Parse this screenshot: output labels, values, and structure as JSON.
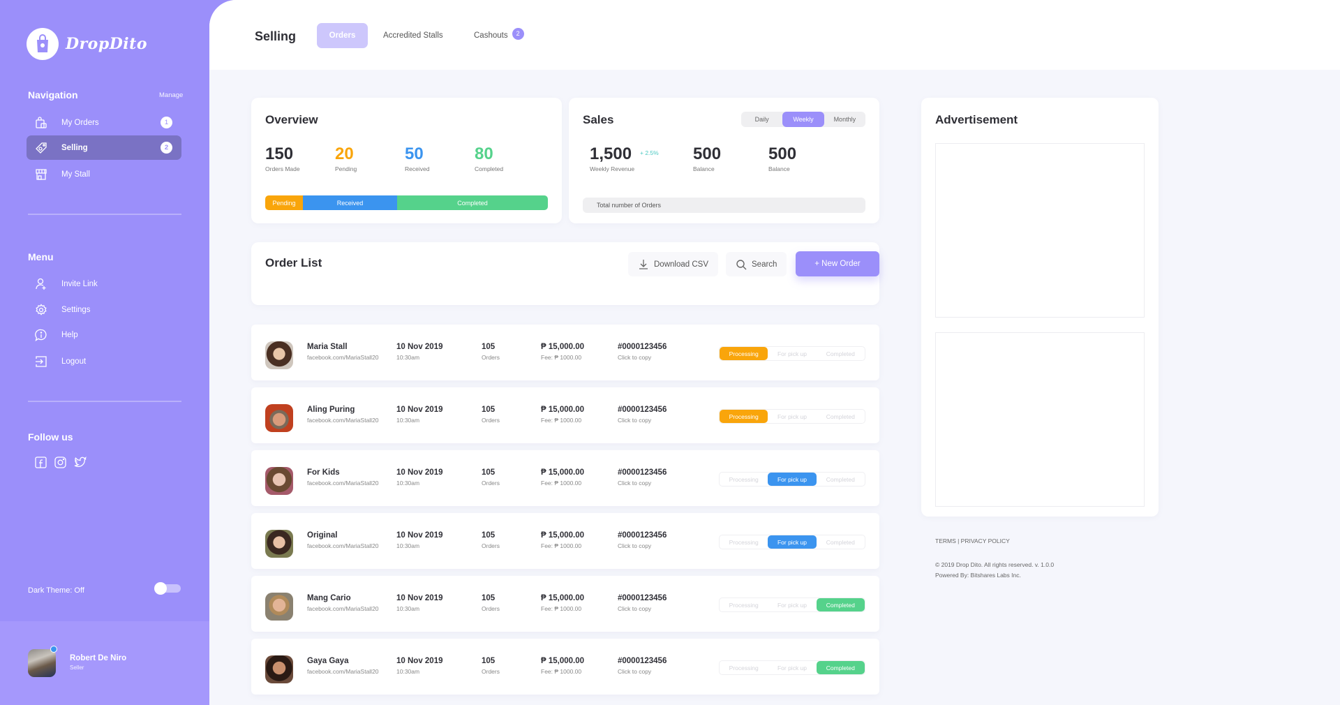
{
  "brand": {
    "name": "DropDito"
  },
  "sidebar": {
    "navigation_title": "Navigation",
    "manage_label": "Manage",
    "nav_items": [
      {
        "label": "My Orders",
        "icon": "shopping-bag-icon",
        "badge": "1"
      },
      {
        "label": "Selling",
        "icon": "tag-icon",
        "badge": "2",
        "active": true
      },
      {
        "label": "My Stall",
        "icon": "store-icon"
      }
    ],
    "menu_title": "Menu",
    "menu_items": [
      {
        "label": "Invite Link",
        "icon": "user-plus-icon"
      },
      {
        "label": "Settings",
        "icon": "gear-icon"
      },
      {
        "label": "Help",
        "icon": "help-chat-icon"
      },
      {
        "label": "Logout",
        "icon": "logout-icon"
      }
    ],
    "follow_title": "Follow us",
    "social": [
      "facebook-icon",
      "instagram-icon",
      "twitter-icon"
    ],
    "dark_theme_label": "Dark Theme: Off",
    "dark_theme_on": false,
    "user": {
      "name": "Robert De Niro",
      "role": "Seller",
      "online": true
    }
  },
  "header": {
    "title": "Selling",
    "tabs": [
      {
        "label": "Orders",
        "active": true
      },
      {
        "label": "Accredited Stalls"
      },
      {
        "label": "Cashouts",
        "badge": "2"
      }
    ]
  },
  "overview": {
    "title": "Overview",
    "stats": [
      {
        "value": "150",
        "label": "Orders Made",
        "color": "#2f2f36"
      },
      {
        "value": "20",
        "label": "Pending",
        "color": "#f9a50b"
      },
      {
        "value": "50",
        "label": "Received",
        "color": "#3b94ef"
      },
      {
        "value": "80",
        "label": "Completed",
        "color": "#55d28b"
      }
    ],
    "bar": [
      {
        "label": "Pending",
        "value": 20,
        "color": "#f9a50b"
      },
      {
        "label": "Received",
        "value": 50,
        "color": "#3b94ef"
      },
      {
        "label": "Completed",
        "value": 80,
        "color": "#55d28b"
      }
    ]
  },
  "sales": {
    "title": "Sales",
    "periods": [
      "Daily",
      "Weekly",
      "Monthly"
    ],
    "active_period": "Weekly",
    "stats": [
      {
        "value": "1,500",
        "label": "Weekly Revenue",
        "growth": "+ 2.5%"
      },
      {
        "value": "500",
        "label": "Balance"
      },
      {
        "value": "500",
        "label": "Balance"
      }
    ],
    "total_orders_label": "Total number of Orders"
  },
  "order_list": {
    "title": "Order List",
    "download_label": "Download CSV",
    "search_label": "Search",
    "new_order_label": "+ New Order",
    "status_options": [
      "Processing",
      "For pick up",
      "Completed"
    ],
    "rows": [
      {
        "name": "Maria Stall",
        "link": "facebook.com/MariaStall20",
        "date": "10 Nov 2019",
        "time": "10:30am",
        "orders": "105",
        "orders_label": "Orders",
        "amount": "₱ 15,000.00",
        "fee": "Fee: ₱ 1000.00",
        "order_id": "#0000123456",
        "copy_label": "Click to copy",
        "status": "Processing"
      },
      {
        "name": "Aling Puring",
        "link": "facebook.com/MariaStall20",
        "date": "10 Nov 2019",
        "time": "10:30am",
        "orders": "105",
        "orders_label": "Orders",
        "amount": "₱ 15,000.00",
        "fee": "Fee: ₱ 1000.00",
        "order_id": "#0000123456",
        "copy_label": "Click to copy",
        "status": "Processing"
      },
      {
        "name": "For Kids",
        "link": "facebook.com/MariaStall20",
        "date": "10 Nov 2019",
        "time": "10:30am",
        "orders": "105",
        "orders_label": "Orders",
        "amount": "₱ 15,000.00",
        "fee": "Fee: ₱ 1000.00",
        "order_id": "#0000123456",
        "copy_label": "Click to copy",
        "status": "For pick up"
      },
      {
        "name": "Original",
        "link": "facebook.com/MariaStall20",
        "date": "10 Nov 2019",
        "time": "10:30am",
        "orders": "105",
        "orders_label": "Orders",
        "amount": "₱ 15,000.00",
        "fee": "Fee: ₱ 1000.00",
        "order_id": "#0000123456",
        "copy_label": "Click to copy",
        "status": "For pick up"
      },
      {
        "name": "Mang Cario",
        "link": "facebook.com/MariaStall20",
        "date": "10 Nov 2019",
        "time": "10:30am",
        "orders": "105",
        "orders_label": "Orders",
        "amount": "₱ 15,000.00",
        "fee": "Fee: ₱ 1000.00",
        "order_id": "#0000123456",
        "copy_label": "Click to copy",
        "status": "Completed"
      },
      {
        "name": "Gaya Gaya",
        "link": "facebook.com/MariaStall20",
        "date": "10 Nov 2019",
        "time": "10:30am",
        "orders": "105",
        "orders_label": "Orders",
        "amount": "₱ 15,000.00",
        "fee": "Fee: ₱ 1000.00",
        "order_id": "#0000123456",
        "copy_label": "Click to copy",
        "status": "Completed"
      }
    ]
  },
  "advertisement": {
    "title": "Advertisement"
  },
  "footer": {
    "links": "TERMS | PRIVACY POLICY",
    "copyright": "© 2019 Drop Dito. All rights reserved. v. 1.0.0",
    "powered_by": "Powered By: Bitshares Labs Inc."
  },
  "colors": {
    "accent": "#9b8ffa",
    "pending": "#f9a50b",
    "received": "#3b94ef",
    "completed": "#55d28b"
  }
}
